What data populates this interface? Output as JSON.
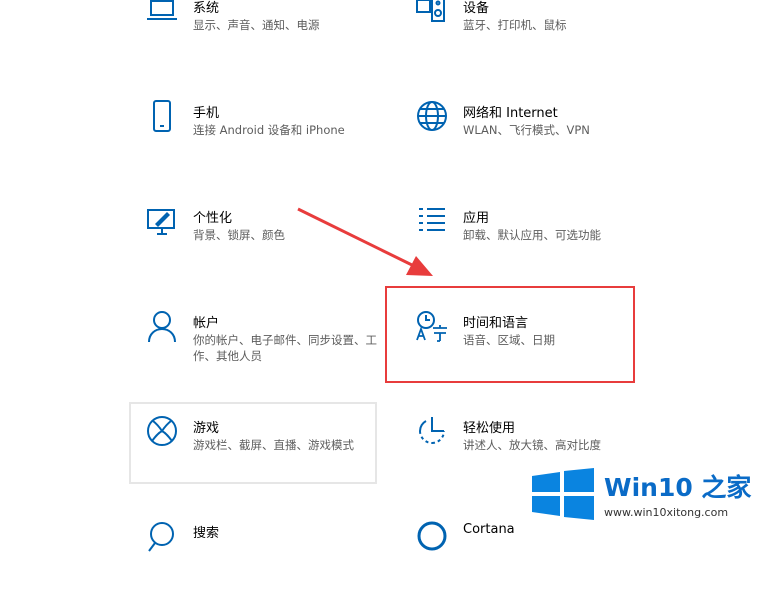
{
  "tiles": [
    {
      "id": "system",
      "title": "系统",
      "desc": "显示、声音、通知、电源",
      "icon": "laptop-icon"
    },
    {
      "id": "devices",
      "title": "设备",
      "desc": "蓝牙、打印机、鼠标",
      "icon": "keyboard-speaker-icon"
    },
    {
      "id": "phone",
      "title": "手机",
      "desc": "连接 Android 设备和 iPhone",
      "icon": "phone-icon"
    },
    {
      "id": "network",
      "title": "网络和 Internet",
      "desc": "WLAN、飞行模式、VPN",
      "icon": "globe-icon"
    },
    {
      "id": "personalization",
      "title": "个性化",
      "desc": "背景、锁屏、颜色",
      "icon": "paint-monitor-icon"
    },
    {
      "id": "apps",
      "title": "应用",
      "desc": "卸载、默认应用、可选功能",
      "icon": "list-icon"
    },
    {
      "id": "accounts",
      "title": "帐户",
      "desc": "你的帐户、电子邮件、同步设置、工作、其他人员",
      "icon": "person-icon"
    },
    {
      "id": "time",
      "title": "时间和语言",
      "desc": "语音、区域、日期",
      "icon": "time-language-icon"
    },
    {
      "id": "gaming",
      "title": "游戏",
      "desc": "游戏栏、截屏、直播、游戏模式",
      "icon": "xbox-icon"
    },
    {
      "id": "ease",
      "title": "轻松使用",
      "desc": "讲述人、放大镜、高对比度",
      "icon": "ease-of-access-icon"
    },
    {
      "id": "search",
      "title": "搜索",
      "desc": "",
      "icon": "search-icon"
    },
    {
      "id": "cortana",
      "title": "Cortana",
      "desc": "",
      "icon": "cortana-icon"
    }
  ],
  "accent_color": "#0063b1",
  "highlight_color": "#e83c3c",
  "watermark": {
    "title": "Win10 之家",
    "url": "www.win10xitong.com"
  }
}
